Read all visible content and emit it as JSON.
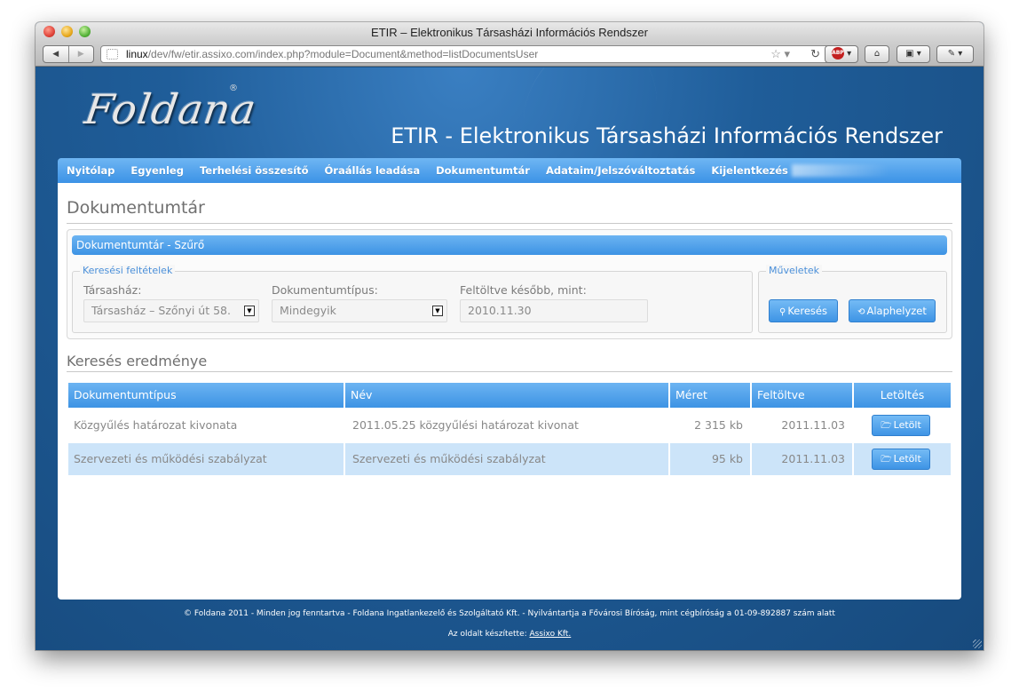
{
  "window": {
    "title": "ETIR – Elektronikus Társasházi Információs Rendszer"
  },
  "browser": {
    "url_host": "linux",
    "url_path": "/dev/fw/etir.assixo.com/index.php?module=Document&method=listDocumentsUser",
    "star_icon": "star-icon",
    "reload_icon": "reload-icon",
    "abp_label": "ABP"
  },
  "site": {
    "logo_text": "Foldana",
    "logo_reg": "®",
    "title": "ETIR - Elektronikus Társasházi Információs Rendszer"
  },
  "menu": [
    {
      "label": "Nyitólap"
    },
    {
      "label": "Egyenleg"
    },
    {
      "label": "Terhelési összesítő"
    },
    {
      "label": "Óraállás leadása"
    },
    {
      "label": "Dokumentumtár"
    },
    {
      "label": "Adataim/Jelszóváltoztatás"
    },
    {
      "label": "Kijelentkezés"
    }
  ],
  "page": {
    "title": "Dokumentumtár",
    "filter": {
      "header": "Dokumentumtár - Szűrő",
      "criteria_legend": "Keresési feltételek",
      "actions_legend": "Műveletek",
      "house_label": "Társasház:",
      "house_value": "Társasház – Szőnyi út 58.",
      "doctype_label": "Dokumentumtípus:",
      "doctype_value": "Mindegyik",
      "uploaded_label": "Feltöltve később, mint:",
      "uploaded_value": "2010.11.30",
      "search_button": "Keresés",
      "reset_button": "Alaphelyzet"
    },
    "results": {
      "title": "Keresés eredménye",
      "columns": [
        "Dokumentumtípus",
        "Név",
        "Méret",
        "Feltöltve",
        "Letöltés"
      ],
      "rows": [
        {
          "type": "Közgyűlés határozat kivonata",
          "name": "2011.05.25 közgyűlési határozat kivonat",
          "size": "2 315 kb",
          "uploaded": "2011.11.03",
          "download": "Letölt"
        },
        {
          "type": "Szervezeti és működési szabályzat",
          "name": "Szervezeti és működési szabályzat",
          "size": "95 kb",
          "uploaded": "2011.11.03",
          "download": "Letölt"
        }
      ]
    }
  },
  "footer": {
    "line1": "© Foldana 2011 - Minden jog fenntartva - Foldana Ingatlankezelő és Szolgáltató Kft. - Nyilvántartja a Fővárosi Bíróság, mint cégbíróság a 01-09-892887 szám alatt",
    "line2_prefix": "Az oldalt készítette: ",
    "line2_link": "Assixo Kft."
  }
}
